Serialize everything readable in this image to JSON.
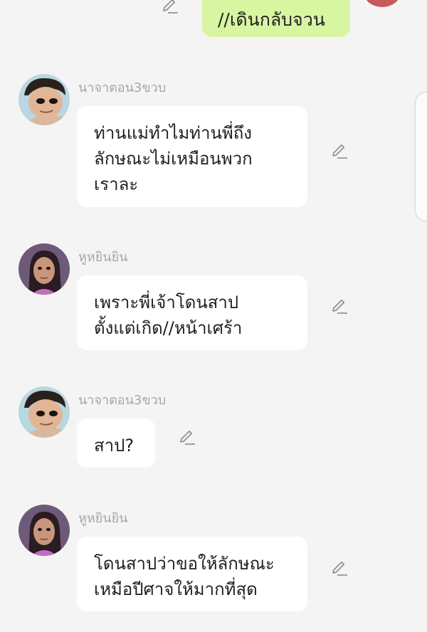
{
  "top": {
    "message": "//เดินกลับจวน"
  },
  "messages": [
    {
      "sender": "นาจาตอน3ขวบ",
      "lines": [
        "ท่านแม่ทำไมท่านพี่ถึง",
        "ลักษณะไม่เหมือนพวก",
        "เราละ"
      ]
    },
    {
      "sender": "หูหยินยิน",
      "lines": [
        "เพราะพี่เจ้าโดนสาป",
        "ตั้งแต่เกิด//หน้าเศร้า"
      ]
    },
    {
      "sender": "นาจาตอน3ขวบ",
      "lines": [
        "สาป?"
      ]
    },
    {
      "sender": "หูหยินยิน",
      "lines": [
        "โดนสาปว่าขอให้ลักษณะ",
        "เหมือปีศาจให้มากที่สุด"
      ]
    }
  ],
  "colors": {
    "background": "#f4f4f4",
    "own_bubble": "#d8f5a2",
    "bubble": "#ffffff",
    "name_text": "#a7a7a7"
  },
  "icons": {
    "edit": "pencil-edit-icon"
  }
}
